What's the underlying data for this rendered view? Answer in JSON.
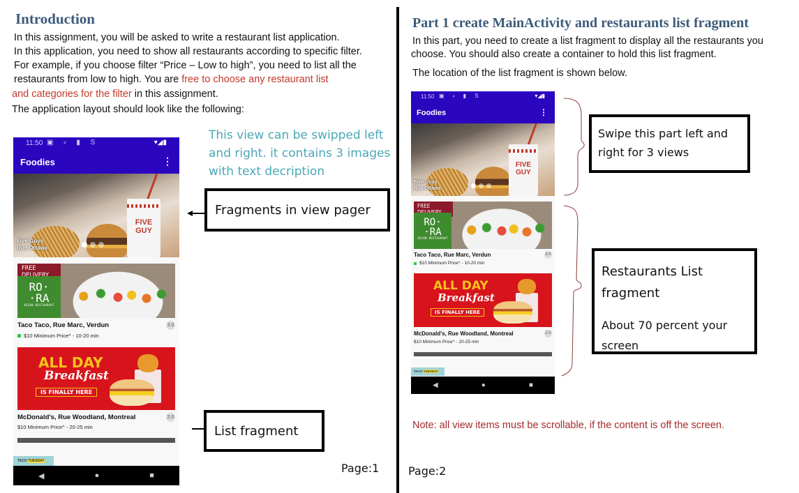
{
  "page1": {
    "heading": "Introduction",
    "paragraph": {
      "line1": "In this assignment, you will be asked to write a restaurant list application.",
      "line2": "In this application, you need  to show all restaurants according to specific filter.",
      "line3": "For example, if you choose filter “Price – Low to  high”, you need to list all the",
      "line4_start": "restaurants from low to high. You are ",
      "line4_red": "free to choose any restaurant list",
      "line5_red": "and categories for the filter",
      "line5_end": " in this assignment.",
      "line6": "The application layout should look like the following:"
    },
    "annotation_cyan": [
      "This view can be swipped left",
      "and right. it contains 3 images",
      "with text decription"
    ],
    "callout_viewpager": "Fragments in view pager",
    "callout_list": "List fragment",
    "page_number": "Page:1"
  },
  "page2": {
    "heading": "Part 1 create MainActivity and restaurants list fragment",
    "paragraph": {
      "line1": "In this part, you need to create a list fragment to display all the restaurants you",
      "line2": "choose.  You should also  create a container to hold this list fragment.",
      "line3": "The location of the list fragment is shown below."
    },
    "callout_swipe": [
      "Swipe this part left and",
      "right for 3 views"
    ],
    "callout_list": {
      "title_line1": "Restaurants List",
      "title_line2": "fragment",
      "note_line1": "About 70 percent your",
      "note_line2": "screen"
    },
    "note": "Note: all view items must be scrollable, if the content is off the screen.",
    "page_number": "Page:2"
  },
  "phone": {
    "status_time": "11:50",
    "status_icons": [
      "notification-icon",
      "usb-icon",
      "sd-card-icon",
      "sync-icon"
    ],
    "status_right_icons": [
      "wifi-icon",
      "signal-icon",
      "battery-icon"
    ],
    "app_title": "Foodies",
    "overflow_menu": "⋮",
    "hero": {
      "caption_line1": "Five Guys",
      "caption_line2": "Rue Ottawa",
      "cup_brand": "FIVE GUY",
      "pager_dots": 3,
      "active_dot": 1
    },
    "restaurants": [
      {
        "badge": "FREE DELIVERY",
        "logo_line1": "RO·",
        "logo_line2": "·RA",
        "logo_sub": "VEGAN RESTAURANT",
        "name": "Taco Taco, Rue Marc, Verdun",
        "rating": "3.0",
        "meta": "$10 Minimum Price^ - 10-20 min",
        "status_color": "#2ecc40"
      },
      {
        "promo_line1": "ALL DAY",
        "promo_line2": "Breakfast",
        "promo_line3": "IS FINALLY HERE",
        "name": "McDonald's, Rue Woodland, Montreal",
        "rating": "2.0",
        "meta": "$10 Minimum Price^ - 20-25 min"
      }
    ],
    "peek_item": {
      "left": "TACO",
      "right": "TUESDAY"
    },
    "nav": {
      "back": "◀",
      "home": "●",
      "recents": "■"
    }
  },
  "colors": {
    "heading": "#3c5a7a",
    "accent_red": "#c0392b",
    "annotation_cyan": "#4aa7b8",
    "app_bar": "#2a06bf",
    "bracket": "#8b3a3a"
  }
}
